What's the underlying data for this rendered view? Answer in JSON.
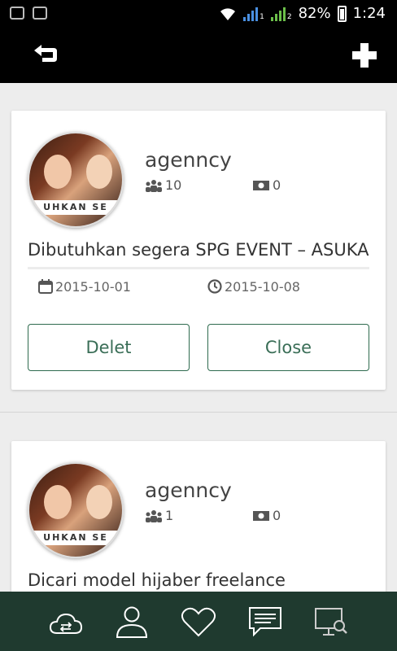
{
  "status_bar": {
    "battery": "82%",
    "time": "1:24",
    "sim1": "1",
    "sim2": "2"
  },
  "posts": [
    {
      "agency": "agenncy",
      "avatar_text": "UHKAN SE",
      "people_count": "10",
      "money_count": "0",
      "title": "Dibutuhkan segera SPG EVENT – ASUKA",
      "start_date": "2015-10-01",
      "end_date": "2015-10-08",
      "delete_label": "Delet",
      "close_label": "Close"
    },
    {
      "agency": "agenncy",
      "avatar_text": "UHKAN SE",
      "people_count": "1",
      "money_count": "0",
      "title": "Dicari model hijaber freelance"
    }
  ],
  "colors": {
    "accent": "#2f6b4f",
    "bottom_nav": "#1f3a2f",
    "toolbar": "#000000"
  }
}
